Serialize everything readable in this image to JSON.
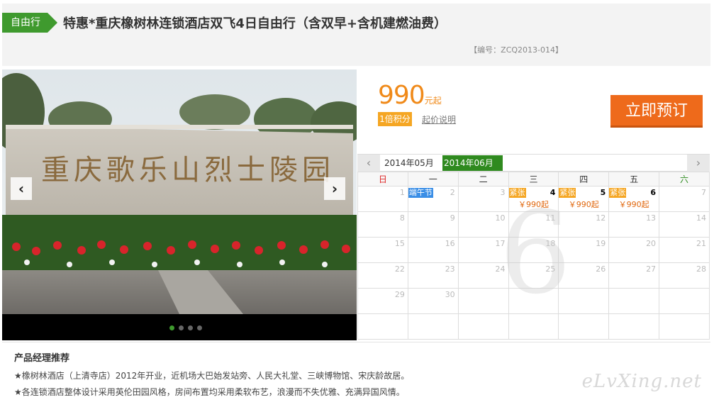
{
  "header": {
    "tag": "自由行",
    "title": "特惠*重庆橡树林连锁酒店双飞4日自由行（含双早+含机建燃油费）",
    "code": "【编号：ZCQ2013-014】"
  },
  "gallery": {
    "prev_label": "‹",
    "next_label": "›",
    "dot_count": 4,
    "active_dot": 1,
    "inscription": "重庆歌乐山烈士陵园"
  },
  "price": {
    "amount": "990",
    "unit": "元起",
    "points_badge": "1倍积分",
    "note_link": "起价说明",
    "book_button": "立即预订"
  },
  "calendar": {
    "prev_icon": "‹",
    "next_icon": "›",
    "months": [
      "2014年05月",
      "2014年06月"
    ],
    "selected_month": "2014年06月",
    "weekdays": [
      "日",
      "一",
      "二",
      "三",
      "四",
      "五",
      "六"
    ],
    "big_month_digit": "6",
    "weeks": [
      [
        {
          "day": "1",
          "active": false
        },
        {
          "day": "2",
          "active": false,
          "festival": "端午节"
        },
        {
          "day": "3",
          "active": false
        },
        {
          "day": "4",
          "active": true,
          "status": "紧张",
          "price": "￥990起"
        },
        {
          "day": "5",
          "active": true,
          "status": "紧张",
          "price": "￥990起"
        },
        {
          "day": "6",
          "active": true,
          "status": "紧张",
          "price": "￥990起"
        },
        {
          "day": "7",
          "active": false
        }
      ],
      [
        {
          "day": "8"
        },
        {
          "day": "9"
        },
        {
          "day": "10"
        },
        {
          "day": "11"
        },
        {
          "day": "12"
        },
        {
          "day": "13"
        },
        {
          "day": "14"
        }
      ],
      [
        {
          "day": "15"
        },
        {
          "day": "16"
        },
        {
          "day": "17"
        },
        {
          "day": "18"
        },
        {
          "day": "19"
        },
        {
          "day": "20"
        },
        {
          "day": "21"
        }
      ],
      [
        {
          "day": "22"
        },
        {
          "day": "23"
        },
        {
          "day": "24"
        },
        {
          "day": "25"
        },
        {
          "day": "26"
        },
        {
          "day": "27"
        },
        {
          "day": "28"
        }
      ],
      [
        {
          "day": "29"
        },
        {
          "day": "30"
        },
        {
          "day": ""
        },
        {
          "day": ""
        },
        {
          "day": ""
        },
        {
          "day": ""
        },
        {
          "day": ""
        }
      ],
      [
        {
          "day": ""
        },
        {
          "day": ""
        },
        {
          "day": ""
        },
        {
          "day": ""
        },
        {
          "day": ""
        },
        {
          "day": ""
        },
        {
          "day": ""
        }
      ]
    ]
  },
  "recommend": {
    "title": "产品经理推荐",
    "lines": [
      "★橡树林酒店（上清寺店）2012年开业，近机场大巴始发站旁、人民大礼堂、三峡博物馆、宋庆龄故居。",
      "★各连锁酒店整体设计采用英伦田园风格，房间布置均采用柔软布艺，浪漫而不失优雅、充满异国风情。"
    ],
    "watermark": "eLvXing.net"
  },
  "colors": {
    "brand_green": "#3f9a2e",
    "price_orange": "#f08a1a",
    "book_orange": "#ee6a1b"
  }
}
